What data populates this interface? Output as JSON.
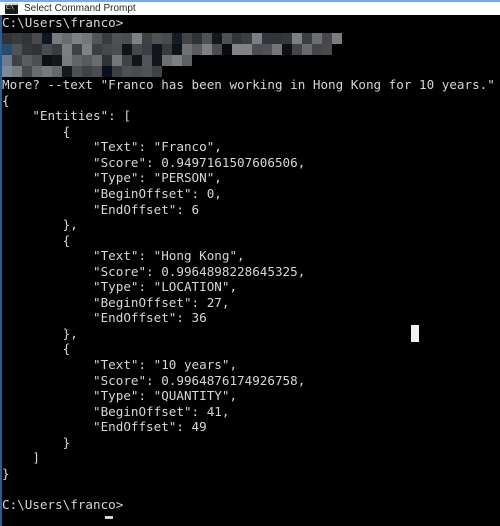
{
  "window": {
    "title": "Select Command Prompt",
    "icon": "command-prompt-icon",
    "icon_glyph": "C:\\",
    "accent_color": "#6eaee8",
    "titlebar_bg": "#ffffff",
    "titlebar_fg": "#2b2b2b",
    "console_bg": "#000000",
    "console_fg": "#d6d6d6",
    "border_color": "#2a5c95"
  },
  "terminal": {
    "prompt_top": "C:\\Users\\franco>",
    "redacted_note": "redacted-pixelated-command-region",
    "continuation_line": "More? --text \"Franco has been working in Hong Kong for 10 years.\"",
    "prompt_bottom": "C:\\Users\\franco>",
    "caret": "_",
    "lines": [
      "C:\\Users\\franco>",
      "",
      "",
      "",
      "More? --text \"Franco has been working in Hong Kong for 10 years.\"",
      "{",
      "    \"Entities\": [",
      "        {",
      "            \"Text\": \"Franco\",",
      "            \"Score\": 0.9497161507606506,",
      "            \"Type\": \"PERSON\",",
      "            \"BeginOffset\": 0,",
      "            \"EndOffset\": 6",
      "        },",
      "        {",
      "            \"Text\": \"Hong Kong\",",
      "            \"Score\": 0.9964898228645325,",
      "            \"Type\": \"LOCATION\",",
      "            \"BeginOffset\": 27,",
      "            \"EndOffset\": 36",
      "        },",
      "        {",
      "            \"Text\": \"10 years\",",
      "            \"Score\": 0.9964876174926758,",
      "            \"Type\": \"QUANTITY\",",
      "            \"BeginOffset\": 41,",
      "            \"EndOffset\": 49",
      "        }",
      "    ]",
      "}",
      "",
      "C:\\Users\\franco>"
    ]
  },
  "output_json": {
    "Entities": [
      {
        "Text": "Franco",
        "Score": 0.9497161507606506,
        "Type": "PERSON",
        "BeginOffset": 0,
        "EndOffset": 6
      },
      {
        "Text": "Hong Kong",
        "Score": 0.9964898228645325,
        "Type": "LOCATION",
        "BeginOffset": 27,
        "EndOffset": 36
      },
      {
        "Text": "10 years",
        "Score": 0.9964876174926758,
        "Type": "QUANTITY",
        "BeginOffset": 41,
        "EndOffset": 49
      }
    ]
  }
}
